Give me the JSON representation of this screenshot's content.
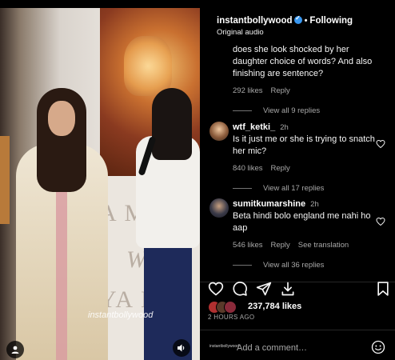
{
  "media": {
    "watermark": "instantbollywood",
    "banner_letters": [
      "A MA",
      "YA I",
      "W"
    ]
  },
  "header": {
    "username": "instantbollywood",
    "separator": "•",
    "follow_label": "Following",
    "audio": "Original audio"
  },
  "comments": [
    {
      "text": "does she look shocked by her daughter choice of words? And also finishing are sentence?",
      "likes": "292 likes",
      "reply": "Reply",
      "view_replies": "View all 9 replies"
    },
    {
      "username": "wtf_ketki_",
      "time": "2h",
      "text": "Is it just me or she is trying to snatch her mic?",
      "likes": "840 likes",
      "reply": "Reply",
      "view_replies": "View all 17 replies"
    },
    {
      "username": "sumitkumarshine",
      "time": "2h",
      "text": "Beta hindi bolo england me nahi ho aap",
      "likes": "546 likes",
      "reply": "Reply",
      "translation": "See translation",
      "view_replies": "View all 36 replies"
    }
  ],
  "engagement": {
    "likes": "237,784 likes",
    "posted": "2 HOURS AGO"
  },
  "composer": {
    "placeholder": "Add a comment…",
    "mini_logo": "instantbollywood"
  },
  "colors": {
    "background": "#000000",
    "verified": "#3897f0",
    "muted_text": "#a8a8a8"
  },
  "icons": [
    "heart-icon",
    "comment-icon",
    "share-icon",
    "save-icon",
    "bookmark-icon",
    "emoji-icon",
    "user-tag-icon",
    "sound-icon"
  ]
}
